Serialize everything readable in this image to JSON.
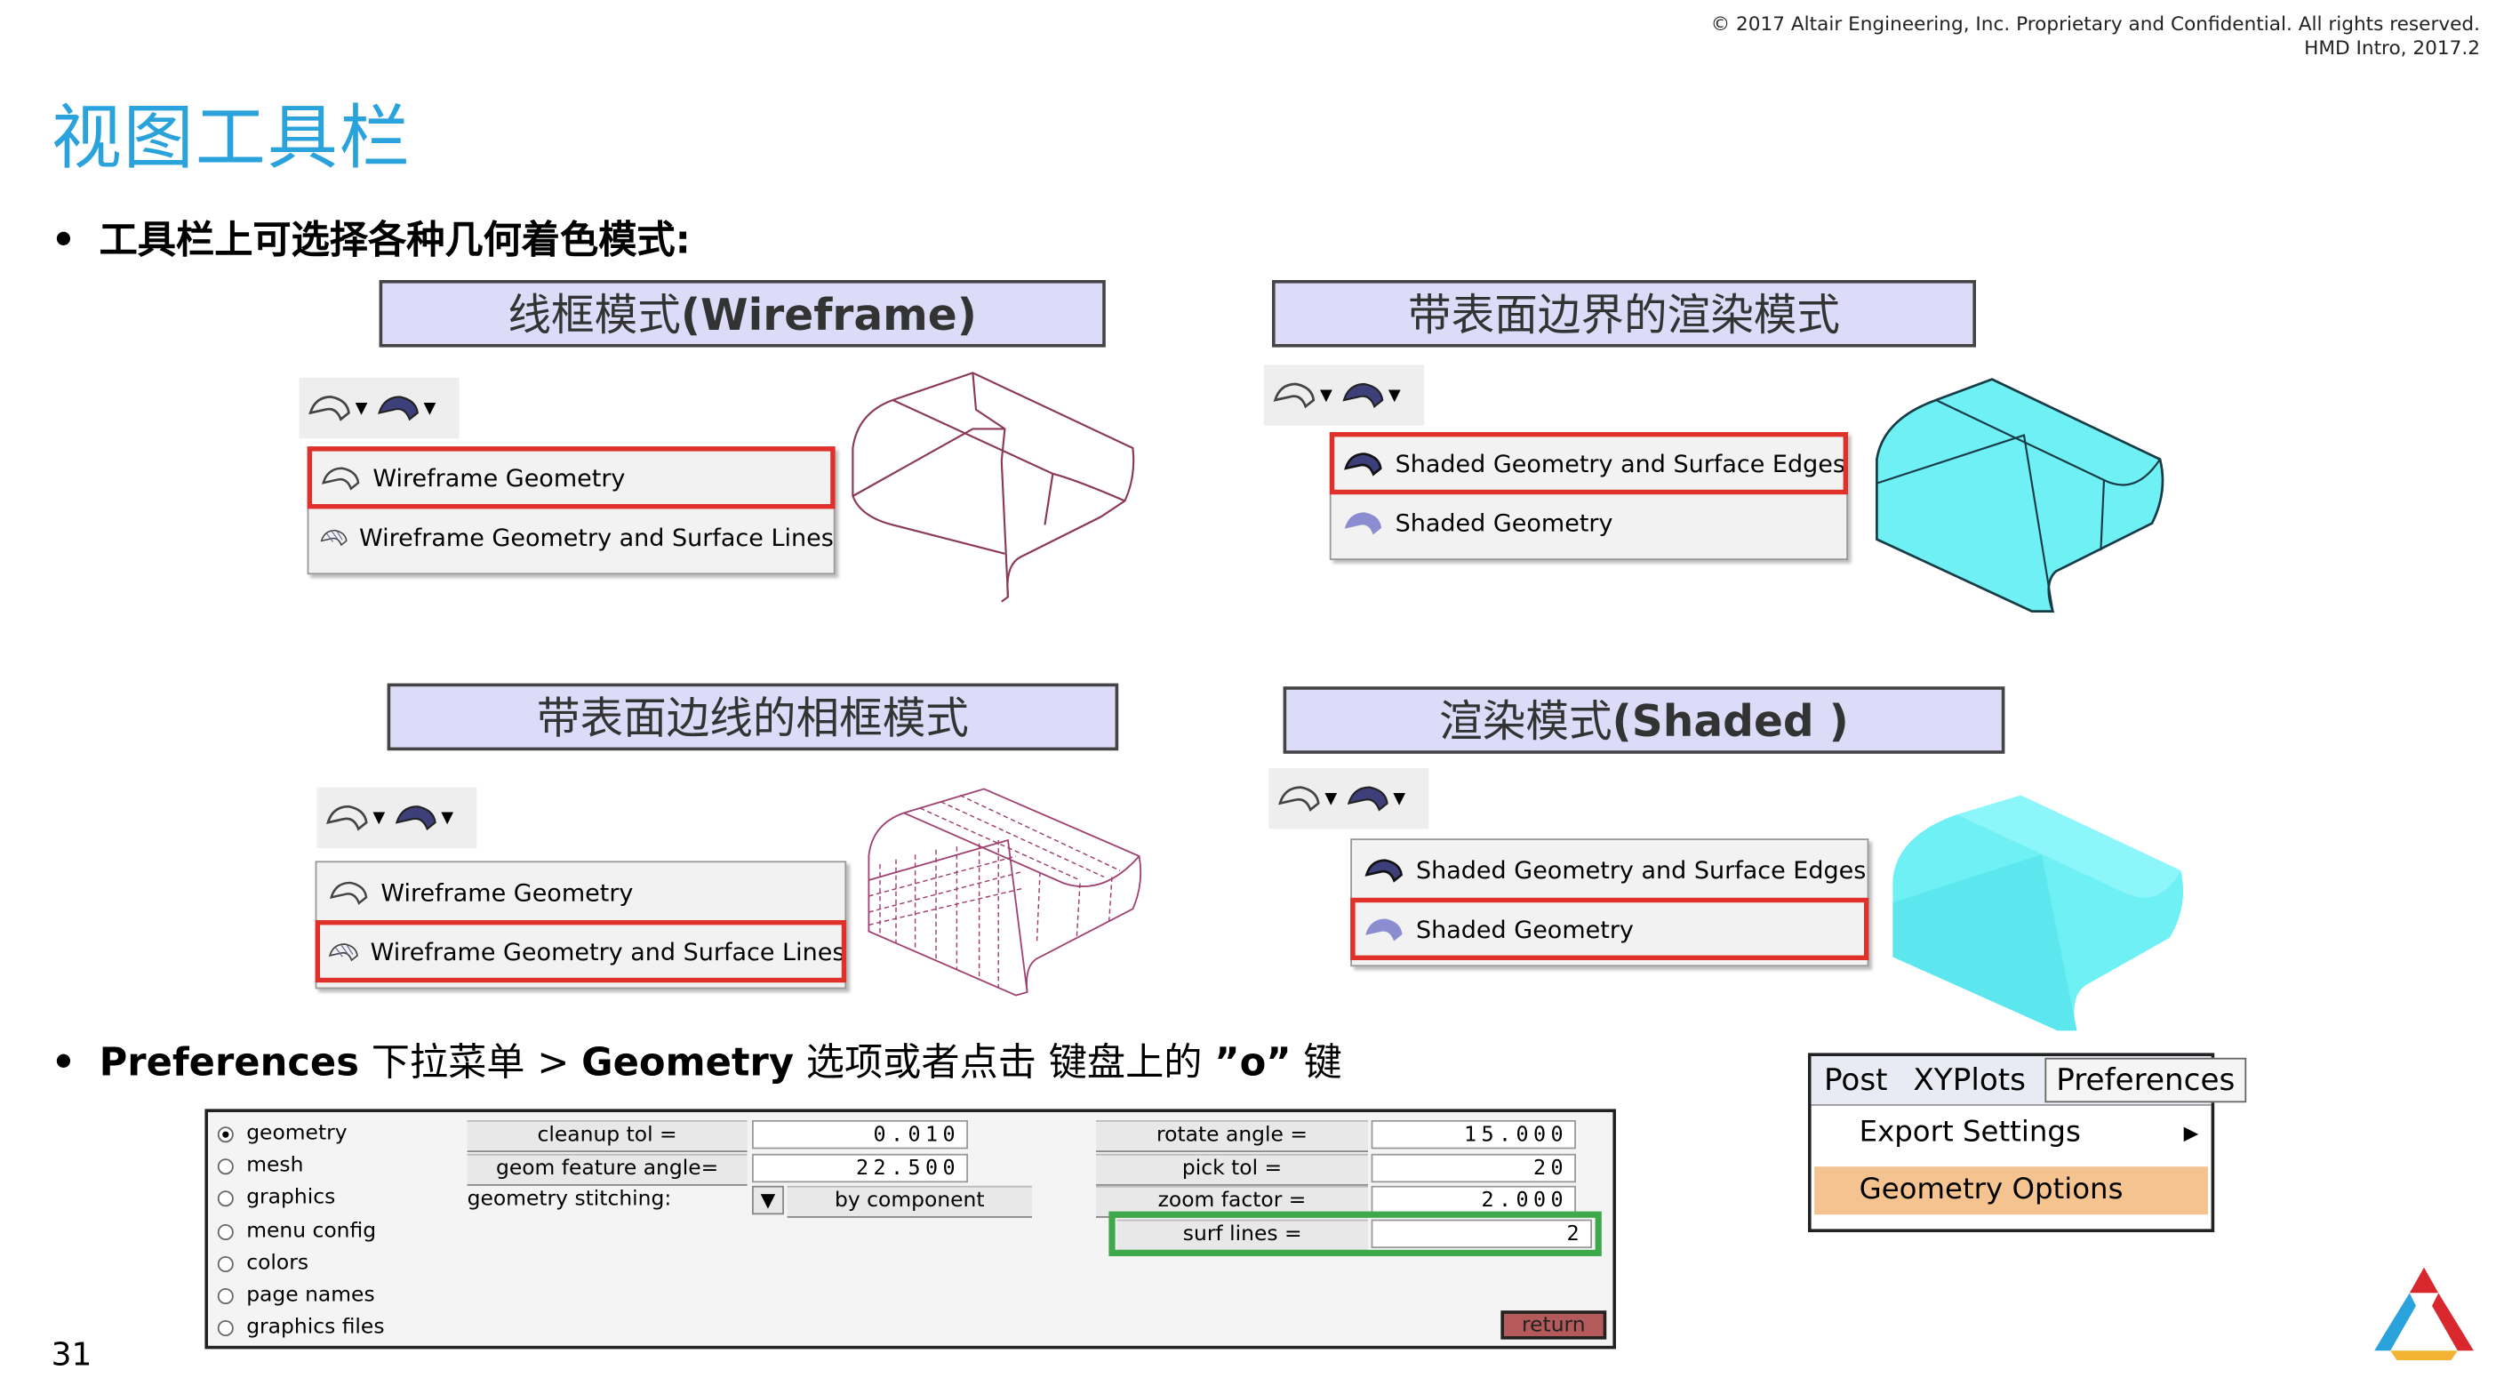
{
  "copyright": {
    "line1": "© 2017 Altair Engineering, Inc. Proprietary and Confidential. All rights reserved.",
    "line2": "HMD Intro, 2017.2"
  },
  "title": "视图工具栏",
  "bullet1": "工具栏上可选择各种几何着色模式:",
  "bullet2_parts": {
    "a": "Preferences",
    "b": " 下拉菜单 > ",
    "c": "Geometry",
    "d": " 选项或者点击 键盘上的 ",
    "e": "”o”",
    "f": " 键"
  },
  "panels": [
    {
      "title": "线框模式",
      "title_latin": "(Wireframe)",
      "items": [
        "Wireframe Geometry",
        "Wireframe Geometry and Surface Lines"
      ],
      "highlighted": 0
    },
    {
      "title": "带表面边界的渲染模式",
      "title_latin": "",
      "items": [
        "Shaded Geometry and Surface Edges",
        "Shaded Geometry"
      ],
      "highlighted": 0
    },
    {
      "title": "带表面边线的相框模式",
      "title_latin": "",
      "items": [
        "Wireframe Geometry",
        "Wireframe Geometry and Surface Lines"
      ],
      "highlighted": 1
    },
    {
      "title": "渲染模式",
      "title_latin": "(Shaded )",
      "items": [
        "Shaded Geometry and Surface Edges",
        "Shaded Geometry"
      ],
      "highlighted": 1
    }
  ],
  "prefs_form": {
    "radios": [
      "geometry",
      "mesh",
      "graphics",
      "menu config",
      "colors",
      "page names",
      "graphics files"
    ],
    "selected_radio": "geometry",
    "cleanup_tol_label": "cleanup tol =",
    "cleanup_tol_value": "0.010",
    "geom_feature_angle_label": "geom feature angle=",
    "geom_feature_angle_value": "22.500",
    "geometry_stitching_label": "geometry stitching:",
    "geometry_stitching_value": "by component",
    "rotate_angle_label": "rotate angle =",
    "rotate_angle_value": "15.000",
    "pick_tol_label": "pick tol =",
    "pick_tol_value": "20",
    "zoom_factor_label": "zoom factor =",
    "zoom_factor_value": "2.000",
    "surf_lines_label": "surf lines =",
    "surf_lines_value": "2",
    "return_label": "return"
  },
  "pref_menu": {
    "menubar": [
      "Post",
      "XYPlots",
      "Preferences"
    ],
    "items": [
      "Export Settings",
      "Geometry Options"
    ]
  },
  "page_number": "31",
  "colors": {
    "title_blue": "#2aa2dc",
    "highlight_red": "#e0302a",
    "highlight_green": "#3ea94a",
    "shaded_cyan": "#6ff0f5",
    "wireframe_pink": "#8a3a55",
    "menu_orange": "#f4c38f"
  }
}
